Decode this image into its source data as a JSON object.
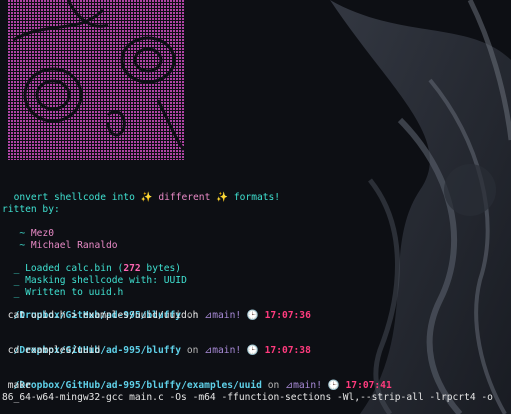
{
  "colors": {
    "background": "#0d0f14",
    "ascii_art": "#c24ab5",
    "accent_cyan": "#3fe0d0",
    "accent_pink": "#ff66b3",
    "path": "#5fd0e8",
    "time": "#ff3b7e"
  },
  "banner": {
    "pre": "onvert shellcode into ",
    "spark_icon": "✨",
    "mid": " different ",
    "post": " formats!"
  },
  "credits": {
    "label": "ritten by:",
    "authors": [
      "Mez0",
      "Michael Ranaldo"
    ],
    "bullet": "~"
  },
  "log": {
    "marker": "_",
    "loaded_pre": "Loaded calc.bin (",
    "loaded_size": "272",
    "loaded_post": " bytes)",
    "masking": "Masking shellcode with: UUID",
    "written": "Written to uuid.h"
  },
  "prompts": [
    {
      "path": "/Dropbox/GitHub/ad-995/bluffy",
      "branch": "main!",
      "time": "17:07:36",
      "command": "cat uuid.h > examples/uuid/uuid.h"
    },
    {
      "path": "/Dropbox/GitHub/ad-995/bluffy",
      "branch": "main!",
      "time": "17:07:38",
      "command": "cd examples/uuid"
    },
    {
      "path": "/Dropbox/GitHub/ad-995/bluffy/examples/uuid",
      "branch": "main!",
      "time": "17:07:41",
      "command": "make"
    }
  ],
  "prompt_words": {
    "on": "on",
    "branch_icon": "⊿",
    "clock_icon": "🕒"
  },
  "make_output": "86_64-w64-mingw32-gcc main.c -Os -m64 -ffunction-sections -Wl,--strip-all -lrpcrt4 -o"
}
